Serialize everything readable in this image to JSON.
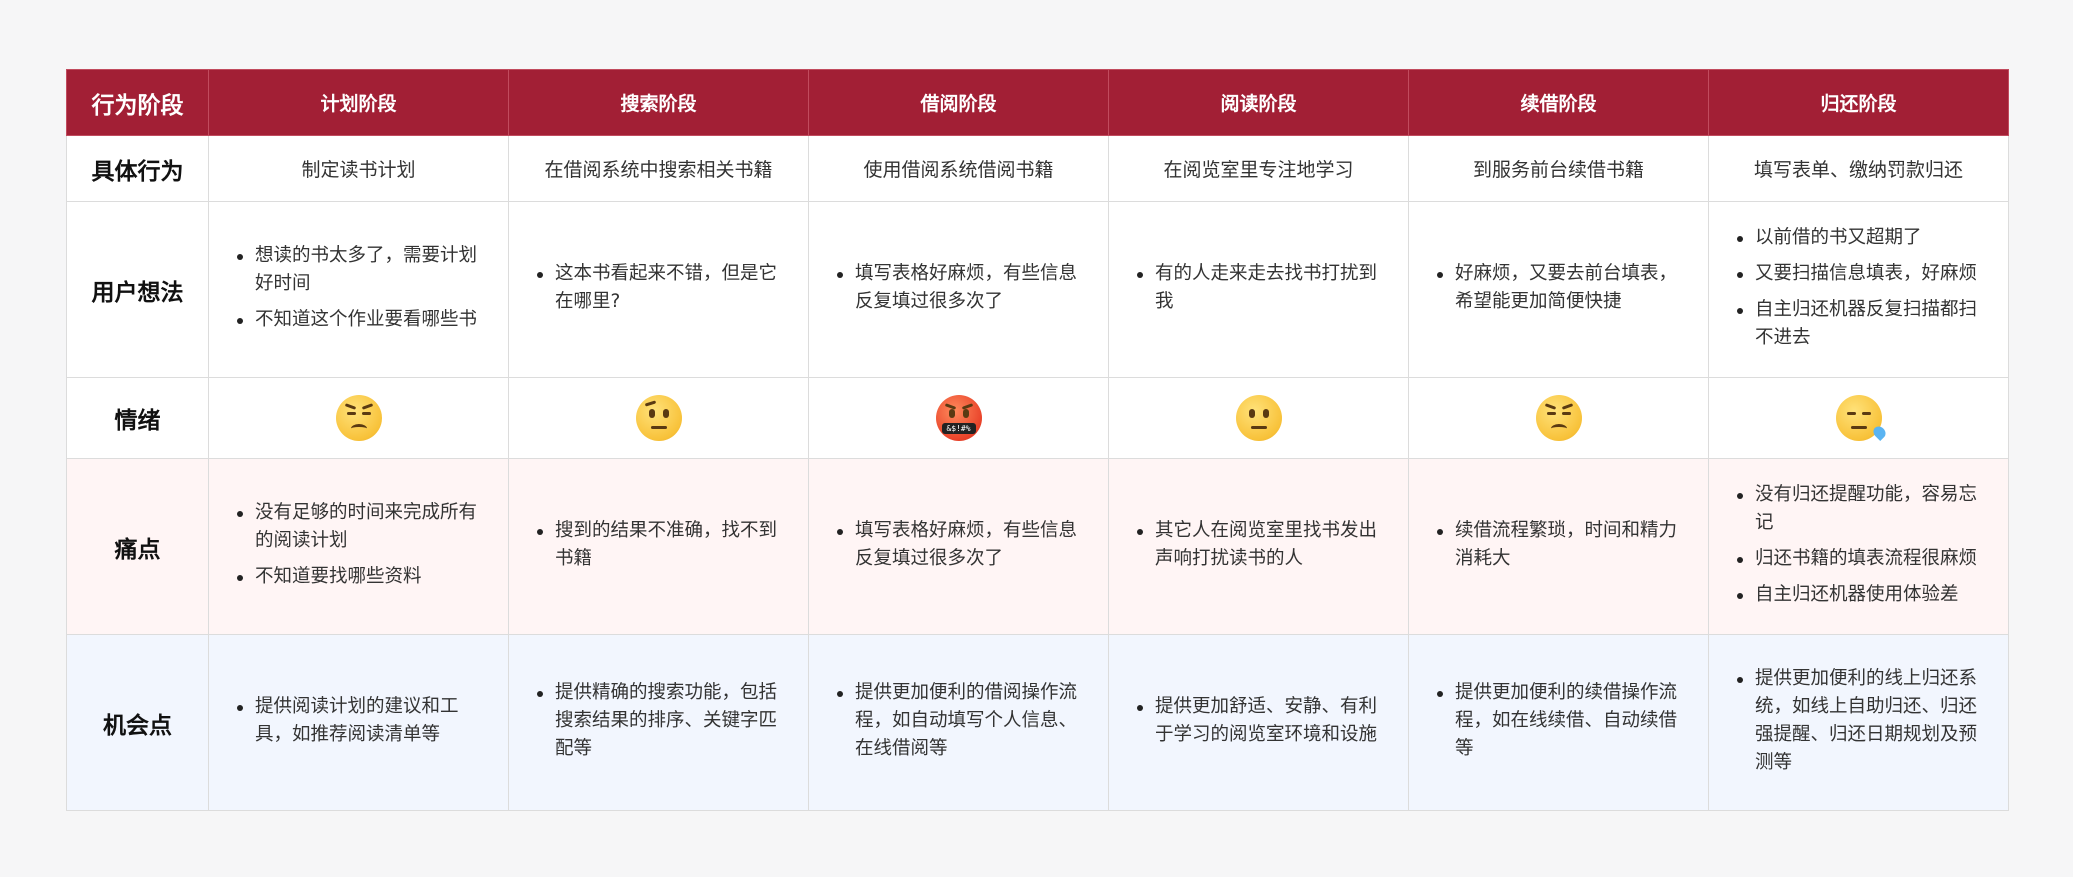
{
  "header": {
    "corner": "行为阶段",
    "stages": [
      "计划阶段",
      "搜索阶段",
      "借阅阶段",
      "阅读阶段",
      "续借阶段",
      "归还阶段"
    ]
  },
  "rows": {
    "behavior": {
      "label": "具体行为",
      "cells": [
        "制定读书计划",
        "在借阅系统中搜索相关书籍",
        "使用借阅系统借阅书籍",
        "在阅览室里专注地学习",
        "到服务前台续借书籍",
        "填写表单、缴纳罚款归还"
      ]
    },
    "thoughts": {
      "label": "用户想法",
      "cells": [
        [
          "想读的书太多了，需要计划好时间",
          "不知道这个作业要看哪些书"
        ],
        [
          "这本书看起来不错，但是它在哪里?"
        ],
        [
          "填写表格好麻烦，有些信息反复填过很多次了"
        ],
        [
          "有的人走来走去找书打扰到我"
        ],
        [
          "好麻烦，又要去前台填表，希望能更加简便快捷"
        ],
        [
          "以前借的书又超期了",
          "又要扫描信息填表，好麻烦",
          "自主归还机器反复扫描都扫不进去"
        ]
      ]
    },
    "emotion": {
      "label": "情绪",
      "cells": [
        "pensive-face-icon",
        "raised-eyebrow-face-icon",
        "cursing-face-icon",
        "neutral-face-icon",
        "pensive-face-icon",
        "sleepy-face-icon"
      ],
      "censor_text": "&$!#%"
    },
    "pain": {
      "label": "痛点",
      "cells": [
        [
          "没有足够的时间来完成所有的阅读计划",
          "不知道要找哪些资料"
        ],
        [
          "搜到的结果不准确，找不到书籍"
        ],
        [
          "填写表格好麻烦，有些信息反复填过很多次了"
        ],
        [
          "其它人在阅览室里找书发出声响打扰读书的人"
        ],
        [
          "续借流程繁琐，时间和精力消耗大"
        ],
        [
          "没有归还提醒功能，容易忘记",
          "归还书籍的填表流程很麻烦",
          "自主归还机器使用体验差"
        ]
      ]
    },
    "opportunity": {
      "label": "机会点",
      "cells": [
        [
          "提供阅读计划的建议和工具，如推荐阅读清单等"
        ],
        [
          "提供精确的搜索功能，包括搜索结果的排序、关键字匹配等"
        ],
        [
          "提供更加便利的借阅操作流程，如自动填写个人信息、在线借阅等"
        ],
        [
          "提供更加舒适、安静、有利于学习的阅览室环境和设施"
        ],
        [
          "提供更加便利的续借操作流程，如在线续借、自动续借等"
        ],
        [
          "提供更加便利的线上归还系统，如线上自助归还、归还强提醒、归还日期规划及预测等"
        ]
      ]
    }
  },
  "colors": {
    "header_bg": "#a21f35",
    "pain_bg": "#fff5f5",
    "opportunity_bg": "#f2f6fe"
  }
}
